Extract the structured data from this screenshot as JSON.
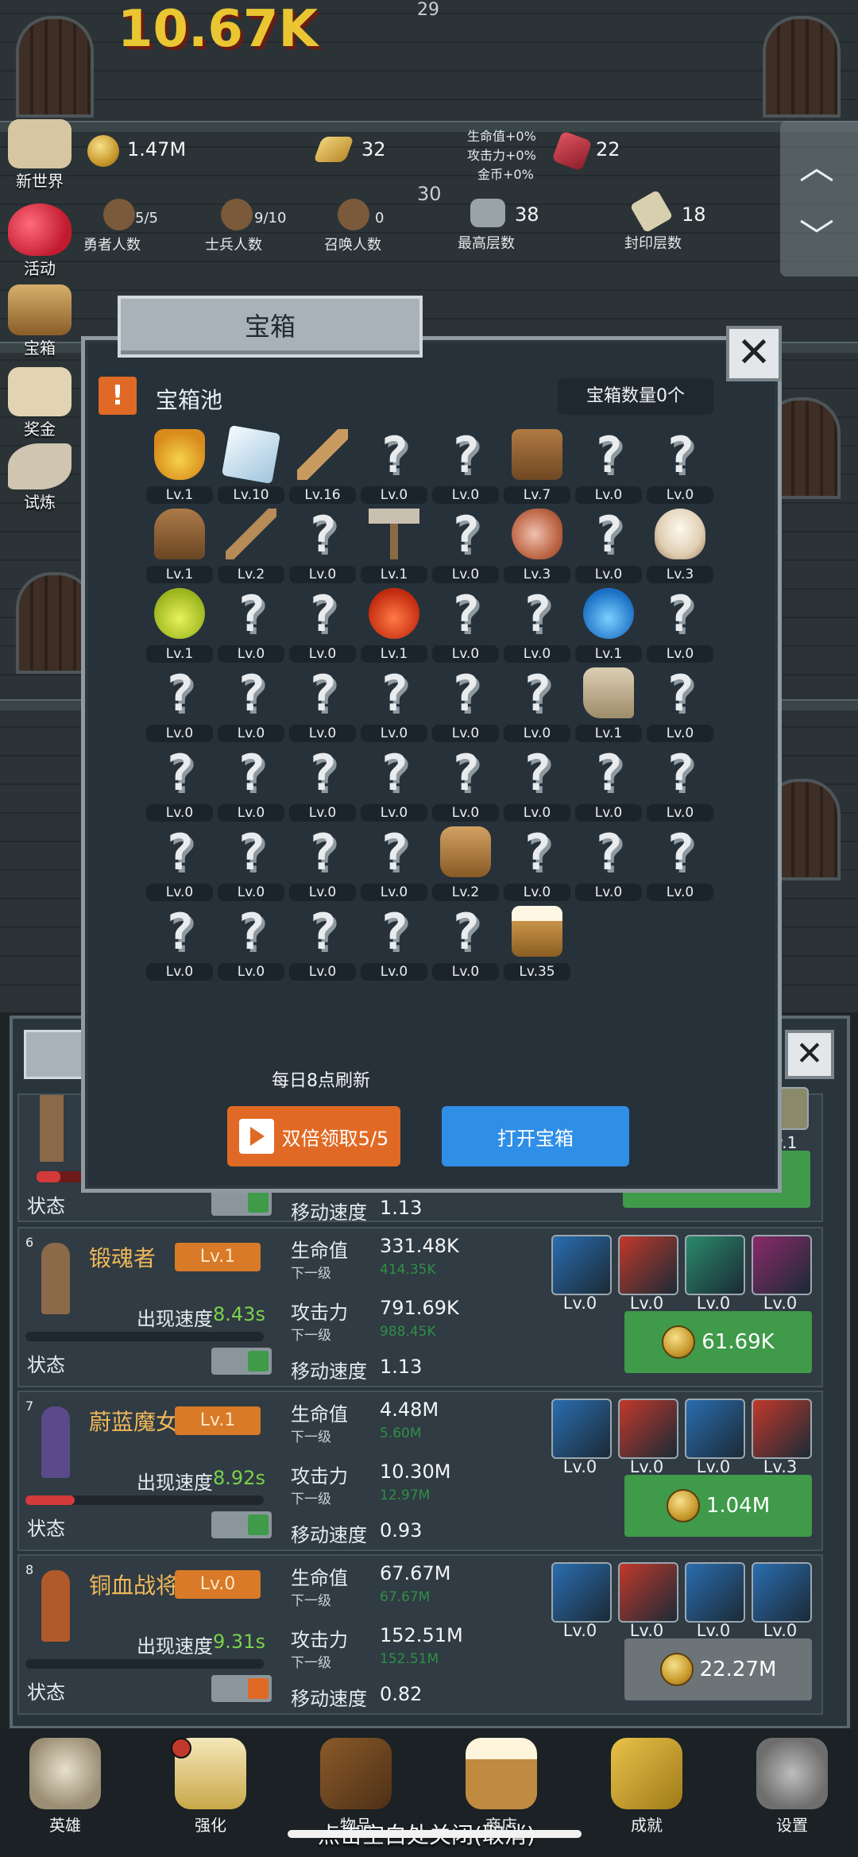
{
  "top": {
    "floor_number_top": "29",
    "floor_number_mid": "30",
    "damage_text": "10.67K",
    "gold": "1.47M",
    "gold_bars": "32",
    "gems": "22",
    "bonus_hp": "生命值+0%",
    "bonus_atk": "攻击力+0%",
    "bonus_gold": "金币+0%",
    "stats": [
      {
        "value": "5/5",
        "label": "勇者人数"
      },
      {
        "value": "9/10",
        "label": "士兵人数"
      },
      {
        "value": "0",
        "label": "召唤人数"
      },
      {
        "value": "38",
        "label": "最高层数"
      },
      {
        "value": "18",
        "label": "封印层数"
      }
    ]
  },
  "sidebar": [
    {
      "label": "新世界"
    },
    {
      "label": "活动"
    },
    {
      "label": "宝箱"
    },
    {
      "label": "奖金"
    },
    {
      "label": "试炼"
    }
  ],
  "chest_modal": {
    "title": "宝箱",
    "pool_label": "宝箱池",
    "chest_count": "宝箱数量0个",
    "refresh_note": "每日8点刷新",
    "double_claim": "双倍领取5/5",
    "open_chest": "打开宝箱",
    "items": [
      {
        "icon": "crown",
        "lv": "Lv.1"
      },
      {
        "icon": "diamond",
        "lv": "Lv.10"
      },
      {
        "icon": "sword",
        "lv": "Lv.16"
      },
      {
        "icon": "unknown",
        "lv": "Lv.0"
      },
      {
        "icon": "unknown",
        "lv": "Lv.0"
      },
      {
        "icon": "armor",
        "lv": "Lv.7"
      },
      {
        "icon": "unknown",
        "lv": "Lv.0"
      },
      {
        "icon": "unknown",
        "lv": "Lv.0"
      },
      {
        "icon": "helmet",
        "lv": "Lv.1"
      },
      {
        "icon": "dagger",
        "lv": "Lv.2"
      },
      {
        "icon": "unknown",
        "lv": "Lv.0"
      },
      {
        "icon": "hammer",
        "lv": "Lv.1"
      },
      {
        "icon": "unknown",
        "lv": "Lv.0"
      },
      {
        "icon": "meat",
        "lv": "Lv.3"
      },
      {
        "icon": "unknown",
        "lv": "Lv.0"
      },
      {
        "icon": "rice-bowl",
        "lv": "Lv.3"
      },
      {
        "icon": "yellow-potion",
        "lv": "Lv.1"
      },
      {
        "icon": "unknown",
        "lv": "Lv.0"
      },
      {
        "icon": "unknown",
        "lv": "Lv.0"
      },
      {
        "icon": "red-potion",
        "lv": "Lv.1"
      },
      {
        "icon": "unknown",
        "lv": "Lv.0"
      },
      {
        "icon": "unknown",
        "lv": "Lv.0"
      },
      {
        "icon": "blue-potion",
        "lv": "Lv.1"
      },
      {
        "icon": "unknown",
        "lv": "Lv.0"
      },
      {
        "icon": "unknown",
        "lv": "Lv.0"
      },
      {
        "icon": "unknown",
        "lv": "Lv.0"
      },
      {
        "icon": "unknown",
        "lv": "Lv.0"
      },
      {
        "icon": "unknown",
        "lv": "Lv.0"
      },
      {
        "icon": "unknown",
        "lv": "Lv.0"
      },
      {
        "icon": "unknown",
        "lv": "Lv.0"
      },
      {
        "icon": "boots",
        "lv": "Lv.1"
      },
      {
        "icon": "unknown",
        "lv": "Lv.0"
      },
      {
        "icon": "unknown",
        "lv": "Lv.0"
      },
      {
        "icon": "unknown",
        "lv": "Lv.0"
      },
      {
        "icon": "unknown",
        "lv": "Lv.0"
      },
      {
        "icon": "unknown",
        "lv": "Lv.0"
      },
      {
        "icon": "unknown",
        "lv": "Lv.0"
      },
      {
        "icon": "unknown",
        "lv": "Lv.0"
      },
      {
        "icon": "unknown",
        "lv": "Lv.0"
      },
      {
        "icon": "unknown",
        "lv": "Lv.0"
      },
      {
        "icon": "unknown",
        "lv": "Lv.0"
      },
      {
        "icon": "unknown",
        "lv": "Lv.0"
      },
      {
        "icon": "unknown",
        "lv": "Lv.0"
      },
      {
        "icon": "unknown",
        "lv": "Lv.0"
      },
      {
        "icon": "backpack",
        "lv": "Lv.2"
      },
      {
        "icon": "unknown",
        "lv": "Lv.0"
      },
      {
        "icon": "unknown",
        "lv": "Lv.0"
      },
      {
        "icon": "unknown",
        "lv": "Lv.0"
      },
      {
        "icon": "unknown",
        "lv": "Lv.0"
      },
      {
        "icon": "unknown",
        "lv": "Lv.0"
      },
      {
        "icon": "unknown",
        "lv": "Lv.0"
      },
      {
        "icon": "unknown",
        "lv": "Lv.0"
      },
      {
        "icon": "unknown",
        "lv": "Lv.0"
      },
      {
        "icon": "beer-mug",
        "lv": "Lv.35"
      }
    ]
  },
  "heroes": {
    "partial": {
      "status": "状态",
      "speed_label": "移动速度",
      "speed": "1.13"
    },
    "rows": [
      {
        "index": "6",
        "name": "锻魂者",
        "lv": "Lv.1",
        "spawn_label": "出现速度",
        "spawn": "8.43s",
        "hp_label": "生命值",
        "hp": "331.48K",
        "next_label": "下一级",
        "hp_next": "414.35K",
        "atk_label": "攻击力",
        "atk": "791.69K",
        "atk_next": "988.45K",
        "speed_label": "移动速度",
        "speed": "1.13",
        "status": "状态",
        "skills": [
          "Lv.0",
          "Lv.0",
          "Lv.0",
          "Lv.0"
        ],
        "cost": "61.69K"
      },
      {
        "index": "7",
        "name": "蔚蓝魔女",
        "lv": "Lv.1",
        "spawn_label": "出现速度",
        "spawn": "8.92s",
        "hp_label": "生命值",
        "hp": "4.48M",
        "next_label": "下一级",
        "hp_next": "5.60M",
        "atk_label": "攻击力",
        "atk": "10.30M",
        "atk_next": "12.97M",
        "speed_label": "移动速度",
        "speed": "0.93",
        "status": "状态",
        "skills": [
          "Lv.0",
          "Lv.0",
          "Lv.0",
          "Lv.3"
        ],
        "cost": "1.04M"
      },
      {
        "index": "8",
        "name": "铜血战将",
        "lv": "Lv.0",
        "spawn_label": "出现速度",
        "spawn": "9.31s",
        "hp_label": "生命值",
        "hp": "67.67M",
        "next_label": "下一级",
        "hp_next": "67.67M",
        "atk_label": "攻击力",
        "atk": "152.51M",
        "atk_next": "152.51M",
        "speed_label": "移动速度",
        "speed": "0.82",
        "status": "状态",
        "skills": [
          "Lv.0",
          "Lv.0",
          "Lv.0",
          "Lv.0"
        ],
        "cost": "22.27M"
      }
    ]
  },
  "nav": [
    {
      "label": "英雄"
    },
    {
      "label": "强化"
    },
    {
      "label": "物品"
    },
    {
      "label": "商店"
    },
    {
      "label": "成就"
    },
    {
      "label": "设置"
    }
  ],
  "close_hint": "点击空白处关闭(取消)",
  "colors": {
    "orange": "#e06a25",
    "blue": "#2f8ee6",
    "green": "#3f9a4a",
    "gray_btn": "#6c7478"
  }
}
